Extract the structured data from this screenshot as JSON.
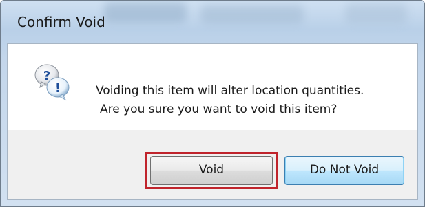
{
  "window": {
    "title": "Confirm Void"
  },
  "dialog": {
    "icon": "question-exclamation-icon",
    "message_line1": "Voiding this item will alter location quantities.",
    "message_line2": "Are you sure you want to void this item?"
  },
  "buttons": {
    "void_label": "Void",
    "do_not_void_label": "Do Not Void"
  },
  "colors": {
    "highlight_border": "#c0242c",
    "default_button_border": "#3c7fb1",
    "titlebar": "#b9d0e8"
  }
}
